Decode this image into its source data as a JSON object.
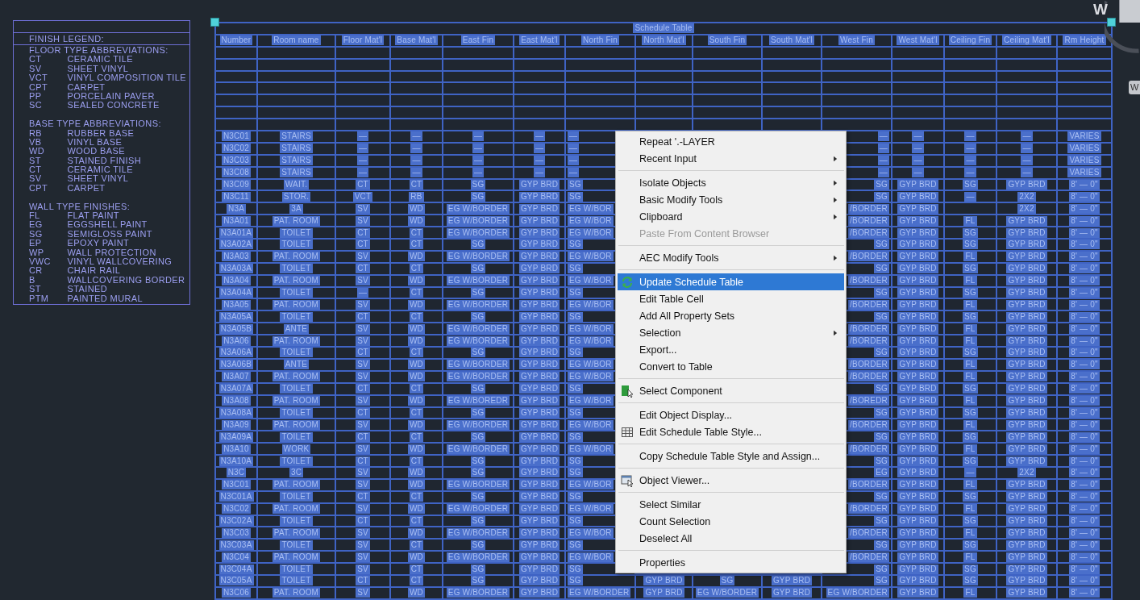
{
  "legend": {
    "title": "FINISH LEGEND:",
    "sections": [
      {
        "heading": "FLOOR TYPE ABBREVIATIONS:",
        "entries": [
          {
            "code": "CT",
            "description": "CERAMIC TILE"
          },
          {
            "code": "SV",
            "description": "SHEET VINYL"
          },
          {
            "code": "VCT",
            "description": "VINYL COMPOSITION TILE"
          },
          {
            "code": "CPT",
            "description": "CARPET"
          },
          {
            "code": "PP",
            "description": "PORCELAIN PAVER"
          },
          {
            "code": "SC",
            "description": "SEALED CONCRETE"
          }
        ]
      },
      {
        "heading": "BASE TYPE ABBREVIATIONS:",
        "entries": [
          {
            "code": "RB",
            "description": "RUBBER BASE"
          },
          {
            "code": "VB",
            "description": "VINYL BASE"
          },
          {
            "code": "WD",
            "description": "WOOD BASE"
          },
          {
            "code": "ST",
            "description": "STAINED FINISH"
          },
          {
            "code": "CT",
            "description": "CERAMIC TILE"
          },
          {
            "code": "SV",
            "description": "SHEET VINYL"
          },
          {
            "code": "CPT",
            "description": "CARPET"
          }
        ]
      },
      {
        "heading": "WALL TYPE FINISHES:",
        "entries": [
          {
            "code": "FL",
            "description": "FLAT PAINT"
          },
          {
            "code": "EG",
            "description": "EGGSHELL PAINT"
          },
          {
            "code": "SG",
            "description": "SEMIGLOSS PAINT"
          },
          {
            "code": "EP",
            "description": "EPOXY PAINT"
          },
          {
            "code": "WP",
            "description": "WALL PROTECTION"
          },
          {
            "code": "VWC",
            "description": "VINYL WALLCOVERING"
          },
          {
            "code": "CR",
            "description": "CHAIR RAIL"
          },
          {
            "code": "B",
            "description": "WALLCOVERING BORDER"
          },
          {
            "code": "ST",
            "description": "STAINED"
          },
          {
            "code": "PTM",
            "description": "PAINTED MURAL"
          }
        ]
      }
    ]
  },
  "schedule_table": {
    "title": "Schedule Table",
    "selected": true,
    "columns": [
      "Number",
      "Room name",
      "Floor Mat'l",
      "Base Mat'l",
      "East Fin",
      "East Mat'l",
      "North Fin",
      "North Mat'l",
      "South Fin",
      "South Mat'l",
      "West Fin",
      "West Mat'l",
      "Ceiling Fin",
      "Ceiling Mat'l",
      "Rm Height"
    ],
    "rows": [
      {
        "cells": [
          null,
          null,
          null,
          null,
          null,
          null,
          null,
          null,
          null,
          null,
          null,
          null,
          null,
          null,
          null
        ]
      },
      {
        "cells": [
          null,
          null,
          null,
          null,
          null,
          null,
          null,
          null,
          null,
          null,
          null,
          null,
          null,
          null,
          null
        ]
      },
      {
        "cells": [
          null,
          null,
          null,
          null,
          null,
          null,
          null,
          null,
          null,
          null,
          null,
          null,
          null,
          null,
          null
        ]
      },
      {
        "cells": [
          null,
          null,
          null,
          null,
          null,
          null,
          null,
          null,
          null,
          null,
          null,
          null,
          null,
          null,
          null
        ]
      },
      {
        "cells": [
          null,
          null,
          null,
          null,
          null,
          null,
          null,
          null,
          null,
          null,
          null,
          null,
          null,
          null,
          null
        ]
      },
      {
        "cells": [
          null,
          null,
          null,
          null,
          null,
          null,
          null,
          null,
          null,
          null,
          null,
          null,
          null,
          null,
          null
        ]
      },
      {
        "cells": [
          null,
          null,
          null,
          null,
          null,
          null,
          null,
          null,
          null,
          null,
          null,
          null,
          null,
          null,
          null
        ]
      },
      {
        "cells": [
          "N3C01",
          "STAIRS",
          "—",
          "—",
          "—",
          "—",
          "—",
          null,
          null,
          null,
          "—",
          "—",
          "—",
          "—",
          "VARIES"
        ]
      },
      {
        "cells": [
          "N3C02",
          "STAIRS",
          "—",
          "—",
          "—",
          "—",
          "—",
          null,
          null,
          null,
          "—",
          "—",
          "—",
          "—",
          "VARIES"
        ]
      },
      {
        "cells": [
          "N3C03",
          "STAIRS",
          "—",
          "—",
          "—",
          "—",
          "—",
          null,
          null,
          null,
          "—",
          "—",
          "—",
          "—",
          "VARIES"
        ]
      },
      {
        "cells": [
          "N3C08",
          "STAIRS",
          "—",
          "—",
          "—",
          "—",
          "—",
          null,
          null,
          null,
          "—",
          "—",
          "—",
          "—",
          "VARIES"
        ]
      },
      {
        "cells": [
          "N3C09",
          "WAIT.",
          "CT",
          "CT",
          "SG",
          "GYP BRD",
          "SG",
          null,
          null,
          null,
          "SG",
          "GYP BRD",
          "SG",
          "GYP BRD",
          "8' — 0\""
        ]
      },
      {
        "cells": [
          "N3C11",
          "STOR.",
          "VCT",
          "RB",
          "SG",
          "GYP BRD",
          "SG",
          null,
          null,
          null,
          "SG",
          "GYP BRD",
          "—",
          "2X2",
          "8' — 0\""
        ]
      },
      {
        "cells": [
          "N3A",
          "3A",
          "SV",
          "WD",
          "EG W/BORDER",
          "GYP BRD",
          "EG W/BOR",
          null,
          null,
          null,
          "/BORDER",
          "GYP BRD",
          null,
          "2X2",
          "8' — 0\""
        ]
      },
      {
        "cells": [
          "N3A01",
          "PAT. ROOM",
          "SV",
          "WD",
          "EG W/BORDER",
          "GYP BRD",
          "EG W/BOR",
          null,
          null,
          null,
          "/BORDER",
          "GYP BRD",
          "FL",
          "GYP BRD",
          "8' — 0\""
        ]
      },
      {
        "cells": [
          "N3A01A",
          "TOILET",
          "CT",
          "CT",
          "EG W/BORDER",
          "GYP BRD",
          "EG W/BOR",
          null,
          null,
          null,
          "/BORDER",
          "GYP BRD",
          "SG",
          "GYP BRD",
          "8' — 0\""
        ]
      },
      {
        "cells": [
          "N3A02A",
          "TOILET",
          "CT",
          "CT",
          "SG",
          "GYP BRD",
          "SG",
          null,
          null,
          null,
          "SG",
          "GYP BRD",
          "SG",
          "GYP BRD",
          "8' — 0\""
        ]
      },
      {
        "cells": [
          "N3A03",
          "PAT. ROOM",
          "SV",
          "WD",
          "EG W/BORDER",
          "GYP BRD",
          "EG W/BOR",
          null,
          null,
          null,
          "/BORDER",
          "GYP BRD",
          "FL",
          "GYP BRD",
          "8' — 0\""
        ]
      },
      {
        "cells": [
          "N3A03A",
          "TOILET",
          "CT",
          "CT",
          "SG",
          "GYP BRD",
          "SG",
          null,
          null,
          null,
          "SG",
          "GYP BRD",
          "SG",
          "GYP BRD",
          "8' — 0\""
        ]
      },
      {
        "cells": [
          "N3A04",
          "PAT. ROOM",
          "SV",
          "WD",
          "EG W/BORDER",
          "GYP BRD",
          "EG W/BOR",
          null,
          null,
          null,
          "/BORDER",
          "GYP BRD",
          "FL",
          "GYP BRD",
          "8' — 0\""
        ]
      },
      {
        "cells": [
          "N3A04A",
          "TOILET",
          "—",
          "CT",
          "SG",
          "GYP BRD",
          "SG",
          null,
          null,
          null,
          "SG",
          "GYP BRD",
          "SG",
          "GYP BRD",
          "8' — 0\""
        ]
      },
      {
        "cells": [
          "N3A05",
          "PAT. ROOM",
          "SV",
          "WD",
          "EG W/BORDER",
          "GYP BRD",
          "EG W/BOR",
          null,
          null,
          null,
          "/BORDER",
          "GYP BRD",
          "FL",
          "GYP BRD",
          "8' — 0\""
        ]
      },
      {
        "cells": [
          "N3A05A",
          "TOILET",
          "CT",
          "CT",
          "SG",
          "GYP BRD",
          "SG",
          null,
          null,
          null,
          "SG",
          "GYP BRD",
          "SG",
          "GYP BRD",
          "8' — 0\""
        ]
      },
      {
        "cells": [
          "N3A05B",
          "ANTE",
          "SV",
          "WD",
          "EG W/BORDER",
          "GYP BRD",
          "EG W/BOR",
          null,
          null,
          null,
          "/BORDER",
          "GYP BRD",
          "FL",
          "GYP BRD",
          "8' — 0\""
        ]
      },
      {
        "cells": [
          "N3A06",
          "PAT. ROOM",
          "SV",
          "WD",
          "EG W/BORDER",
          "GYP BRD",
          "EG W/BOR",
          null,
          null,
          null,
          "/BORDER",
          "GYP BRD",
          "FL",
          "GYP BRD",
          "8' — 0\""
        ]
      },
      {
        "cells": [
          "N3A06A",
          "TOILET",
          "CT",
          "CT",
          "SG",
          "GYP BRD",
          "SG",
          null,
          null,
          null,
          "SG",
          "GYP BRD",
          "SG",
          "GYP BRD",
          "8' — 0\""
        ]
      },
      {
        "cells": [
          "N3A06B",
          "ANTE",
          "SV",
          "WD",
          "EG W/BORDER",
          "GYP BRD",
          "EG W/BOR",
          null,
          null,
          null,
          "/BORDER",
          "GYP BRD",
          "FL",
          "GYP BRD",
          "8' — 0\""
        ]
      },
      {
        "cells": [
          "N3A07",
          "PAT. ROOM",
          "SV",
          "WD",
          "EG W/BORDER",
          "GYP BRD",
          "EG W/BOR",
          null,
          null,
          null,
          "/BORDER",
          "GYP BRD",
          "FL",
          "GYP BRD",
          "8' — 0\""
        ]
      },
      {
        "cells": [
          "N3A07A",
          "TOILET",
          "CT",
          "CT",
          "SG",
          "GYP BRD",
          "SG",
          null,
          null,
          null,
          "SG",
          "GYP BRD",
          "SG",
          "GYP BRD",
          "8' — 0\""
        ]
      },
      {
        "cells": [
          "N3A08",
          "PAT. ROOM",
          "SV",
          "WD",
          "EG W/BOREDR",
          "GYP BRD",
          "EG W/BOR",
          null,
          null,
          null,
          "/BOREDR",
          "GYP BRD",
          "FL",
          "GYP BRD",
          "8' — 0\""
        ]
      },
      {
        "cells": [
          "N3A08A",
          "TOILET",
          "CT",
          "CT",
          "SG",
          "GYP BRD",
          "SG",
          null,
          null,
          null,
          "SG",
          "GYP BRD",
          "SG",
          "GYP BRD",
          "8' — 0\""
        ]
      },
      {
        "cells": [
          "N3A09",
          "PAT. ROOM",
          "SV",
          "WD",
          "EG W/BORDER",
          "GYP BRD",
          "EG W/BOR",
          null,
          null,
          null,
          "/BORDER",
          "GYP BRD",
          "FL",
          "GYP BRD",
          "8' — 0\""
        ]
      },
      {
        "cells": [
          "N3A09A",
          "TOILET",
          "CT",
          "CT",
          "SG",
          "GYP BRD",
          "SG",
          null,
          null,
          null,
          "SG",
          "GYP BRD",
          "SG",
          "GYP BRD",
          "8' — 0\""
        ]
      },
      {
        "cells": [
          "N3A10",
          "WORK",
          "SV",
          "WD",
          "EG W/BORDER",
          "GYP BRD",
          "EG W/BOR",
          null,
          null,
          null,
          "/BORDER",
          "GYP BRD",
          "FL",
          "GYP BRD",
          "8' — 0\""
        ]
      },
      {
        "cells": [
          "N3A10A",
          "TOILET",
          "CT",
          "CT",
          "SG",
          "GYP BRD",
          "SG",
          null,
          null,
          null,
          "SG",
          "GYP BRD",
          "SG",
          "GYP BRD",
          "8' — 0\""
        ]
      },
      {
        "cells": [
          "N3C",
          "3C",
          "SV",
          "WD",
          "SG",
          "GYP BRD",
          "SG",
          null,
          null,
          null,
          "EG",
          "GYP BRD",
          "—",
          "2X2",
          "8' — 0\""
        ]
      },
      {
        "cells": [
          "N3C01",
          "PAT. ROOM",
          "SV",
          "WD",
          "EG W/BORDER",
          "GYP BRD",
          "EG W/BOR",
          null,
          null,
          null,
          "/BORDER",
          "GYP BRD",
          "FL",
          "GYP BRD",
          "8' — 0\""
        ]
      },
      {
        "cells": [
          "N3C01A",
          "TOILET",
          "CT",
          "CT",
          "SG",
          "GYP BRD",
          "SG",
          null,
          null,
          null,
          "SG",
          "GYP BRD",
          "SG",
          "GYP BRD",
          "8' — 0\""
        ]
      },
      {
        "cells": [
          "N3C02",
          "PAT. ROOM",
          "SV",
          "WD",
          "EG W/BORDER",
          "GYP BRD",
          "EG W/BOR",
          null,
          null,
          null,
          "/BORDER",
          "GYP BRD",
          "FL",
          "GYP BRD",
          "8' — 0\""
        ]
      },
      {
        "cells": [
          "N3C02A",
          "TOILET",
          "CT",
          "CT",
          "SG",
          "GYP BRD",
          "SG",
          null,
          null,
          null,
          "SG",
          "GYP BRD",
          "SG",
          "GYP BRD",
          "8' — 0\""
        ]
      },
      {
        "cells": [
          "N3C03",
          "PAT. ROOM",
          "SV",
          "WD",
          "EG W/BORDER",
          "GYP BRD",
          "EG W/BOR",
          null,
          null,
          null,
          "/BORDER",
          "GYP BRD",
          "FL",
          "GYP BRD",
          "8' — 0\""
        ]
      },
      {
        "cells": [
          "N3C03A",
          "TOILET",
          "SV",
          "CT",
          "SG",
          "GYP BRD",
          "SG",
          null,
          null,
          null,
          "SG",
          "GYP BRD",
          "SG",
          "GYP BRD",
          "8' — 0\""
        ]
      },
      {
        "cells": [
          "N3C04",
          "PAT. ROOM",
          "SV",
          "WD",
          "EG W/BORDER",
          "GYP BRD",
          "EG W/BOR",
          null,
          null,
          null,
          "/BORDER",
          "GYP BRD",
          "FL",
          "GYP BRD",
          "8' — 0\""
        ]
      },
      {
        "cells": [
          "N3C04A",
          "TOILET",
          "SV",
          "CT",
          "SG",
          "GYP BRD",
          "SG",
          null,
          null,
          null,
          "SG",
          "GYP BRD",
          "SG",
          "GYP BRD",
          "8' — 0\""
        ]
      },
      {
        "cells": [
          "N3C05A",
          "TOILET",
          "CT",
          "CT",
          "SG",
          "GYP BRD",
          "SG",
          "GYP BRD",
          "SG",
          "GYP BRD",
          "SG",
          "GYP BRD",
          "SG",
          "GYP BRD",
          "8' — 0\""
        ]
      },
      {
        "cells": [
          "N3C06",
          "PAT. ROOM",
          "SV",
          "WD",
          "EG W/BORDER",
          "GYP BRD",
          "EG W/BORDER",
          "GYP BRD",
          "EG W/BORDER",
          "GYP BRD",
          "EG W/BORDER",
          "GYP BRD",
          "FL",
          "GYP BRD",
          "8' — 0\""
        ]
      }
    ]
  },
  "context_menu": {
    "items": [
      {
        "kind": "item",
        "label": "Repeat '.-LAYER",
        "submenu": false,
        "disabled": false,
        "selected": false
      },
      {
        "kind": "item",
        "label": "Recent Input",
        "submenu": true,
        "disabled": false,
        "selected": false
      },
      {
        "kind": "separator"
      },
      {
        "kind": "item",
        "label": "Isolate Objects",
        "submenu": true,
        "disabled": false,
        "selected": false
      },
      {
        "kind": "item",
        "label": "Basic Modify Tools",
        "submenu": true,
        "disabled": false,
        "selected": false
      },
      {
        "kind": "item",
        "label": "Clipboard",
        "submenu": true,
        "disabled": false,
        "selected": false
      },
      {
        "kind": "item",
        "label": "Paste From Content Browser",
        "submenu": false,
        "disabled": true,
        "selected": false
      },
      {
        "kind": "separator"
      },
      {
        "kind": "item",
        "label": "AEC Modify Tools",
        "submenu": true,
        "disabled": false,
        "selected": false
      },
      {
        "kind": "separator"
      },
      {
        "kind": "item",
        "label": "Update Schedule Table",
        "submenu": false,
        "disabled": false,
        "selected": true
      },
      {
        "kind": "item",
        "label": "Edit Table Cell",
        "submenu": false,
        "disabled": false,
        "selected": false
      },
      {
        "kind": "item",
        "label": "Add All Property Sets",
        "submenu": false,
        "disabled": false,
        "selected": false
      },
      {
        "kind": "item",
        "label": "Selection",
        "submenu": true,
        "disabled": false,
        "selected": false
      },
      {
        "kind": "item",
        "label": "Export...",
        "submenu": false,
        "disabled": false,
        "selected": false
      },
      {
        "kind": "item",
        "label": "Convert to Table",
        "submenu": false,
        "disabled": false,
        "selected": false
      },
      {
        "kind": "separator"
      },
      {
        "kind": "item",
        "label": "Select Component",
        "submenu": false,
        "disabled": false,
        "selected": false
      },
      {
        "kind": "separator"
      },
      {
        "kind": "item",
        "label": "Edit Object Display...",
        "submenu": false,
        "disabled": false,
        "selected": false
      },
      {
        "kind": "item",
        "label": "Edit Schedule Table Style...",
        "submenu": false,
        "disabled": false,
        "selected": false
      },
      {
        "kind": "separator"
      },
      {
        "kind": "item",
        "label": "Copy Schedule Table Style and Assign...",
        "submenu": false,
        "disabled": false,
        "selected": false
      },
      {
        "kind": "separator"
      },
      {
        "kind": "item",
        "label": "Object Viewer...",
        "submenu": false,
        "disabled": false,
        "selected": false
      },
      {
        "kind": "separator"
      },
      {
        "kind": "item",
        "label": "Select Similar",
        "submenu": false,
        "disabled": false,
        "selected": false
      },
      {
        "kind": "item",
        "label": "Count Selection",
        "submenu": false,
        "disabled": false,
        "selected": false
      },
      {
        "kind": "item",
        "label": "Deselect All",
        "submenu": false,
        "disabled": false,
        "selected": false
      },
      {
        "kind": "separator"
      },
      {
        "kind": "item",
        "label": "Properties",
        "submenu": false,
        "disabled": false,
        "selected": false
      }
    ]
  },
  "view_cube": {
    "compass_label": "W"
  },
  "navigation_bar": {
    "label": "W"
  }
}
